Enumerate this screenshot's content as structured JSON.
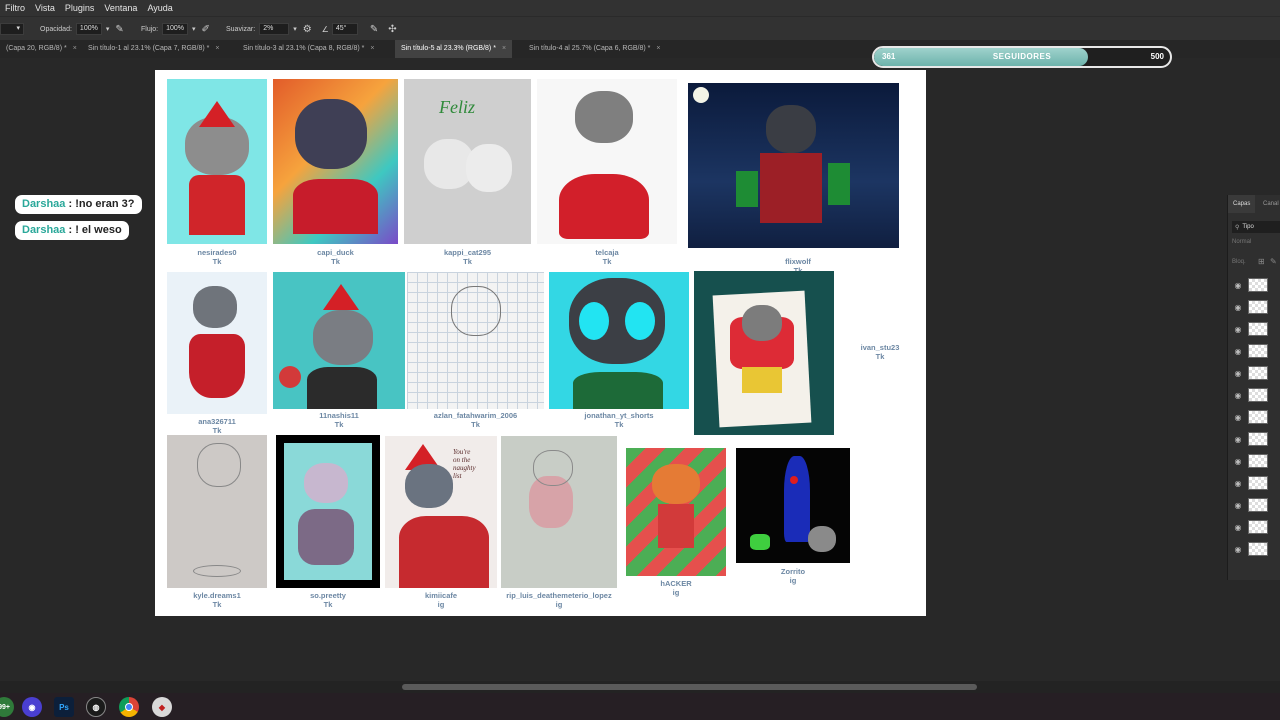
{
  "menu": [
    "Filtro",
    "Vista",
    "Plugins",
    "Ventana",
    "Ayuda"
  ],
  "options": {
    "opacity_label": "Opacidad:",
    "opacity_value": "100%",
    "flow_label": "Flujo:",
    "flow_value": "100%",
    "smooth_label": "Suavizar:",
    "smooth_value": "2%",
    "angle_value": "45°"
  },
  "tabs": [
    "(Capa 20, RGB/8) *",
    "Sin título-1 al 23.1% (Capa 7, RGB/8) *",
    "Sin título-3 al 23.1% (Capa 8, RGB/8) *",
    "Sin título-5 al 23.3% (RGB/8) *",
    "Sin título-4 al 25.7% (Capa 6, RGB/8) *"
  ],
  "followers": {
    "current": "361",
    "label": "SEGUIDORES",
    "target": "500",
    "progress": 0.722
  },
  "chat": [
    {
      "user": "Darshaa",
      "message": ": !no eran 3?"
    },
    {
      "user": "Darshaa",
      "message": ": ! el weso"
    }
  ],
  "artworks": [
    {
      "user": "nesirades0",
      "platform": "Tk"
    },
    {
      "user": "capi_duck",
      "platform": "Tk"
    },
    {
      "user": "kappi_cat295",
      "platform": "Tk"
    },
    {
      "user": "telcaja",
      "platform": "Tk"
    },
    {
      "user": "flixwolf",
      "platform": "Tk"
    },
    {
      "user": "ana326711",
      "platform": "Tk"
    },
    {
      "user": "11nashis11",
      "platform": "Tk"
    },
    {
      "user": "azlan_fatahwarim_2006",
      "platform": "Tk"
    },
    {
      "user": "jonathan_yt_shorts",
      "platform": "Tk"
    },
    {
      "user": "ivan_stu23",
      "platform": "Tk"
    },
    {
      "user": "kyle.dreams1",
      "platform": "Tk"
    },
    {
      "user": "so.preetty",
      "platform": "Tk"
    },
    {
      "user": "kimiicafe",
      "platform": "ig"
    },
    {
      "user": "rip_luis_deathemeterio_lopez",
      "platform": "ig"
    },
    {
      "user": "hACKER",
      "platform": "ig"
    },
    {
      "user": "Zorrito",
      "platform": "ig"
    }
  ],
  "layers_panel": {
    "tab1": "Capas",
    "tab2": "Canal",
    "filter": "Tipo",
    "blend": "Normal",
    "lock": "Bloq."
  },
  "taskbar": {
    "badge": "99+",
    "ps": "Ps"
  }
}
